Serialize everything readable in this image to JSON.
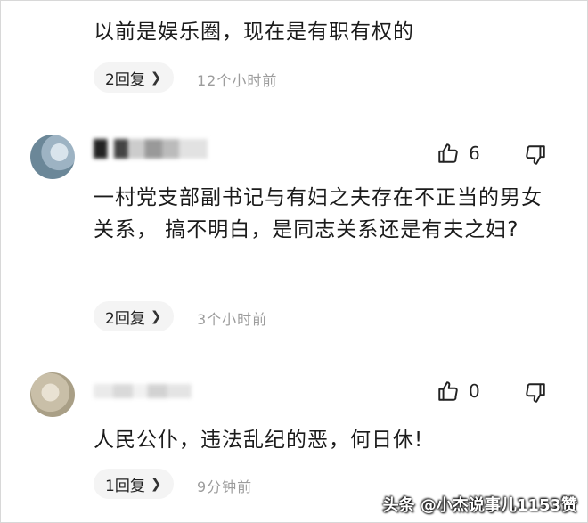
{
  "comments": [
    {
      "text": "以前是娱乐圈，现在是有职有权的",
      "reply_label": "2回复",
      "time": "12个小时前"
    },
    {
      "text": "一村党支部副书记与有妇之夫存在不正当的男女关系，  搞不明白，是同志关系还是有夫之妇?",
      "reply_label": "2回复",
      "time": "3个小时前",
      "likes": "6"
    },
    {
      "text": "人民公仆，违法乱纪的恶，何日休!",
      "reply_label": "1回复",
      "time": "9分钟前",
      "likes": "0"
    }
  ],
  "icons": {
    "chevron": "chevron-right-icon",
    "like": "thumb-up-icon",
    "dislike": "thumb-down-icon"
  },
  "watermark": "头条 @小杰说事儿1153赞"
}
